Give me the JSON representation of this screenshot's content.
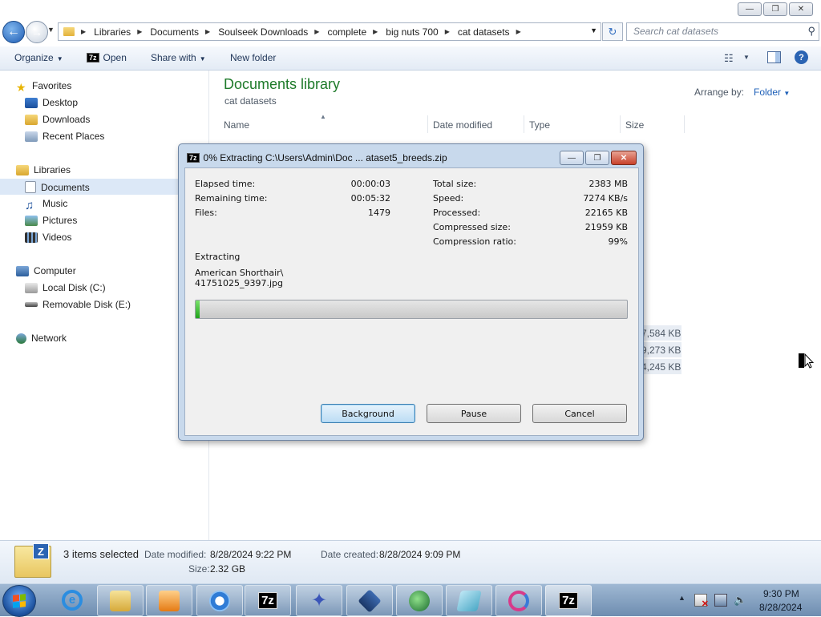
{
  "window": {
    "min_label": "—",
    "max_label": "❐",
    "close_label": "✕"
  },
  "address": {
    "crumbs": [
      "Libraries",
      "Documents",
      "Soulseek Downloads",
      "complete",
      "big nuts 700",
      "cat datasets"
    ],
    "search_placeholder": "Search cat datasets"
  },
  "toolbar": {
    "organize": "Organize",
    "open": "Open",
    "share_with": "Share with",
    "new_folder": "New folder",
    "sevenz_badge": "7z"
  },
  "nav": {
    "favorites": "Favorites",
    "desktop": "Desktop",
    "downloads": "Downloads",
    "recent_places": "Recent Places",
    "libraries": "Libraries",
    "documents": "Documents",
    "music": "Music",
    "pictures": "Pictures",
    "videos": "Videos",
    "computer": "Computer",
    "local_disk": "Local Disk (C:)",
    "removable_disk": "Removable Disk (E:)",
    "network": "Network"
  },
  "content": {
    "title": "Documents library",
    "subtitle": "cat datasets",
    "arrange_label": "Arrange by:",
    "arrange_value": "Folder",
    "columns": {
      "name": "Name",
      "date_modified": "Date modified",
      "type": "Type",
      "size": "Size"
    },
    "visible_sizes": [
      "7,584 KB",
      "9,273 KB",
      "4,245 KB"
    ]
  },
  "details": {
    "selection": "3 items selected",
    "date_modified_label": "Date modified:",
    "date_modified_value": "8/28/2024 9:22 PM",
    "date_created_label": "Date created:",
    "date_created_value": "8/28/2024 9:09 PM",
    "size_label": "Size:",
    "size_value": "2.32 GB"
  },
  "dialog": {
    "title": "0% Extracting C:\\Users\\Admin\\Doc ... ataset5_breeds.zip",
    "badge": "7z",
    "elapsed_label": "Elapsed time:",
    "elapsed_value": "00:00:03",
    "remaining_label": "Remaining time:",
    "remaining_value": "00:05:32",
    "files_label": "Files:",
    "files_value": "1479",
    "total_label": "Total size:",
    "total_value": "2383 MB",
    "speed_label": "Speed:",
    "speed_value": "7274 KB/s",
    "processed_label": "Processed:",
    "processed_value": "22165 KB",
    "compressed_label": "Compressed size:",
    "compressed_value": "21959 KB",
    "ratio_label": "Compression ratio:",
    "ratio_value": "99%",
    "status_label": "Extracting",
    "current_path": "American Shorthair\\",
    "current_file": "41751025_9397.jpg",
    "progress_fraction": 0.01,
    "buttons": {
      "background": "Background",
      "pause": "Pause",
      "cancel": "Cancel"
    }
  },
  "taskbar": {
    "apps": [
      "internet-explorer",
      "file-explorer",
      "media-player",
      "chromium",
      "7-zip",
      "kestrel",
      "virtualbox",
      "network-globe",
      "notepad",
      "swirl",
      "7-zip-active"
    ],
    "sevenz_label": "7z",
    "time": "9:30 PM",
    "date": "8/28/2024"
  }
}
